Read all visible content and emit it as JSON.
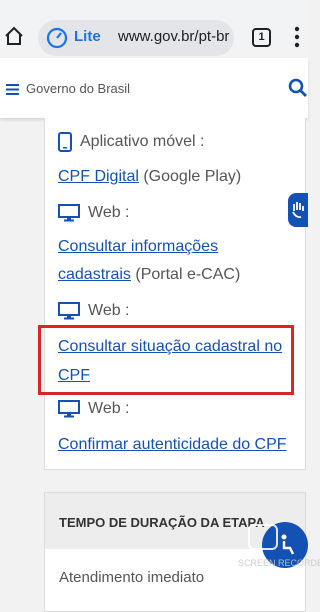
{
  "browser": {
    "lite_label": "Lite",
    "url": "www.gov.br/pt-br",
    "tab_count": "1"
  },
  "header": {
    "title": "Governo do Brasil"
  },
  "content": {
    "app_label": "Aplicativo móvel :",
    "cpf_digital_link": "CPF Digital",
    "cpf_digital_suffix": " (Google Play)",
    "web_label_1": "Web :",
    "consultar_info_line1": "Consultar informações",
    "consultar_info_line2": "cadastrais",
    "consultar_info_suffix": " (Portal e-CAC)",
    "web_label_2": "Web :",
    "consultar_situacao_line1": "Consultar situação cadastral no",
    "consultar_situacao_line2": "CPF",
    "web_label_3": "Web :",
    "confirmar_link": "Confirmar autenticidade do CPF"
  },
  "step": {
    "title": "TEMPO DE DURAÇÃO DA ETAPA",
    "value": "Atendimento imediato"
  },
  "overlay": {
    "watermark_text": "SCREEN RECORDER"
  },
  "colors": {
    "link": "#1351b4",
    "highlight": "#d72626",
    "chrome_accent": "#1a73e8"
  }
}
